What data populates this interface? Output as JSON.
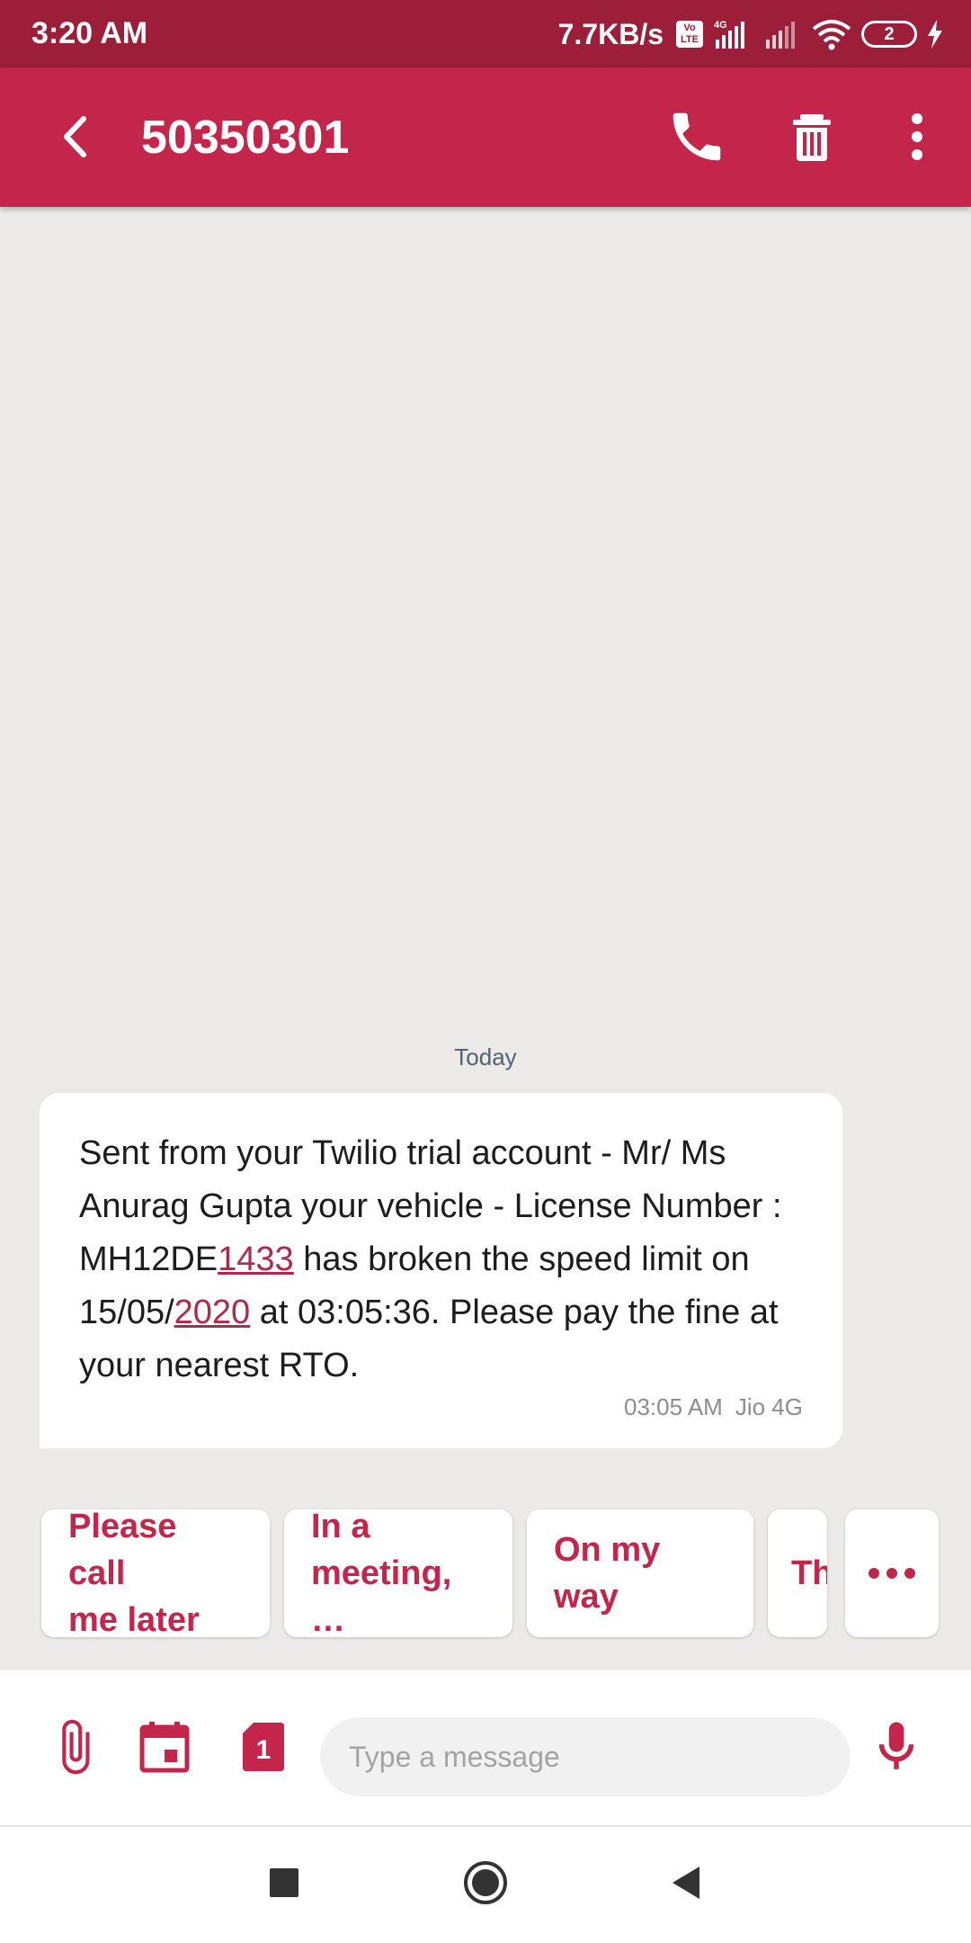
{
  "status_bar": {
    "time": "3:20 AM",
    "net_speed": "7.7KB/s",
    "volte_label": "Vo LTE",
    "network_type": "4G",
    "battery_level": "2",
    "icons": [
      "volte-icon",
      "signal-4g-icon",
      "signal-icon",
      "wifi-icon",
      "battery-icon",
      "charging-icon"
    ]
  },
  "app_bar": {
    "title": "50350301",
    "icons": [
      "back-arrow-icon",
      "phone-icon",
      "trash-icon",
      "more-vert-icon"
    ]
  },
  "conversation": {
    "date_label": "Today",
    "messages": [
      {
        "parts": [
          {
            "text": "Sent from your Twilio trial account - Mr/ Ms Anurag Gupta your vehicle - License Number : MH12DE",
            "link": false
          },
          {
            "text": "1433",
            "link": true
          },
          {
            "text": " has broken the speed limit on 15/05/",
            "link": false
          },
          {
            "text": "2020",
            "link": true
          },
          {
            "text": " at 03:05:36. Please pay the fine at your nearest RTO.",
            "link": false
          }
        ],
        "time": "03:05 AM",
        "sim": "Jio 4G"
      }
    ]
  },
  "quick_replies": {
    "items": [
      "Please call\nme later",
      "In a\nmeeting, …",
      "On my way",
      "Th"
    ],
    "more_icon": "more-horiz-icon"
  },
  "compose": {
    "placeholder": "Type a message",
    "sim_number": "1",
    "icons": [
      "attach-icon",
      "calendar-icon",
      "sim-card-icon",
      "mic-icon"
    ]
  },
  "nav_bar": {
    "icons": [
      "recents-square-icon",
      "home-circle-icon",
      "back-triangle-icon"
    ]
  },
  "colors": {
    "status_bar": "#9c1e38",
    "app_bar": "#c3264a",
    "accent": "#c3264a",
    "background": "#ebeae9"
  }
}
